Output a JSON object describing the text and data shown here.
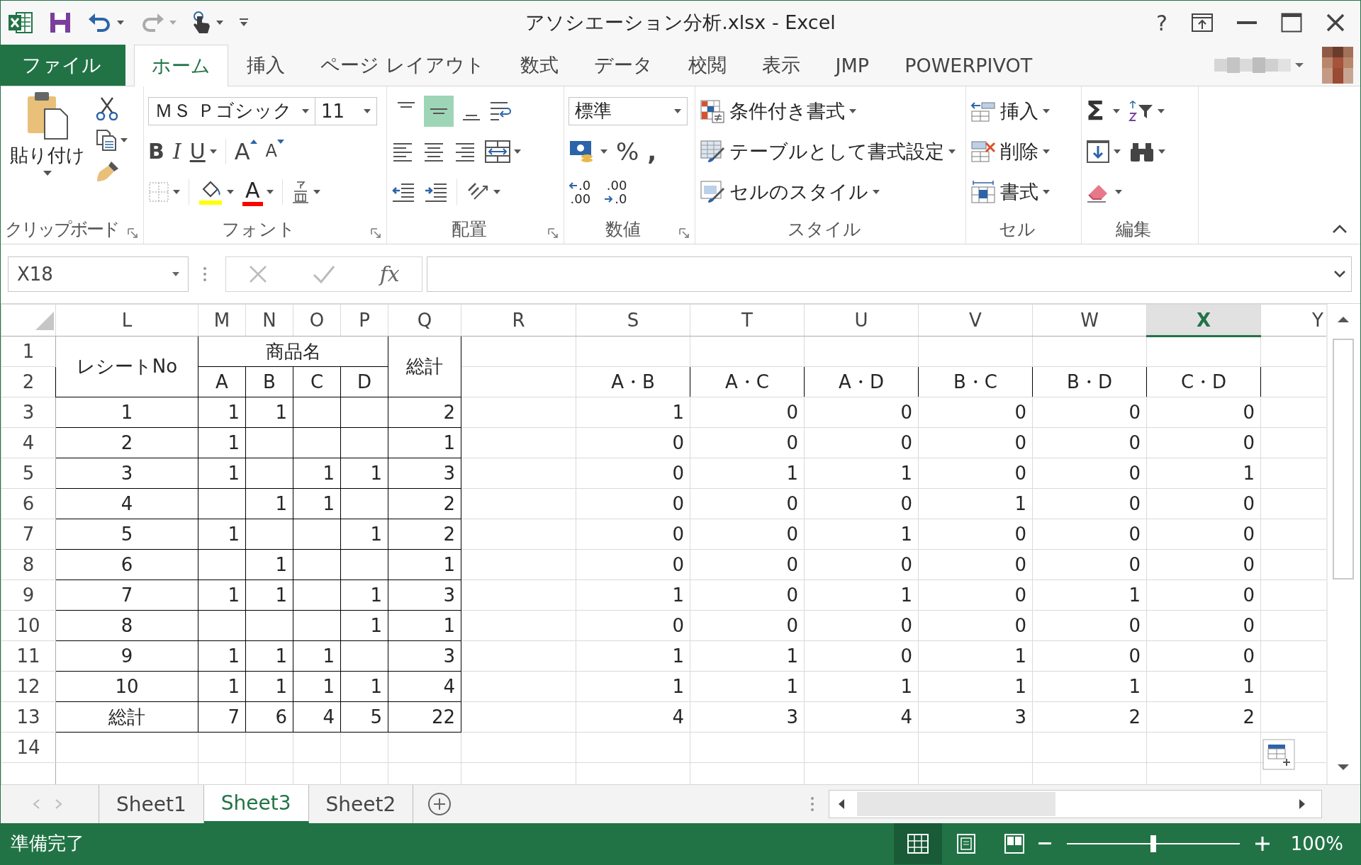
{
  "window": {
    "title": "アソシエーション分析.xlsx - Excel",
    "help": "?"
  },
  "ribbon_tabs": [
    {
      "label": "ファイル",
      "kind": "file",
      "selected": false
    },
    {
      "label": "ホーム",
      "kind": "tab",
      "selected": true
    },
    {
      "label": "挿入",
      "kind": "tab",
      "selected": false
    },
    {
      "label": "ページ レイアウト",
      "kind": "tab",
      "selected": false
    },
    {
      "label": "数式",
      "kind": "tab",
      "selected": false
    },
    {
      "label": "データ",
      "kind": "tab",
      "selected": false
    },
    {
      "label": "校閲",
      "kind": "tab",
      "selected": false
    },
    {
      "label": "表示",
      "kind": "tab",
      "selected": false
    },
    {
      "label": "JMP",
      "kind": "tab",
      "selected": false
    },
    {
      "label": "POWERPIVOT",
      "kind": "tab",
      "selected": false
    }
  ],
  "clipboard": {
    "label": "クリップボード",
    "paste": "貼り付け"
  },
  "font": {
    "label": "フォント",
    "name": "ＭＳ Ｐゴシック",
    "size": "11",
    "bold": "B",
    "italic": "I",
    "underline": "U",
    "grow": "A",
    "shrink": "A",
    "font_color": "A"
  },
  "alignment": {
    "label": "配置",
    "vertical": [
      {
        "kind": "top",
        "selected": false
      },
      {
        "kind": "middle",
        "selected": true
      },
      {
        "kind": "bottom",
        "selected": false
      }
    ]
  },
  "number": {
    "label": "数値",
    "format": "標準",
    "percent": "%",
    "comma": ",",
    "inc_decimal": [
      ".0",
      ".00"
    ],
    "dec_decimal": [
      ".00",
      ".0"
    ]
  },
  "styles": {
    "label": "スタイル",
    "items": [
      {
        "kind": "conditional",
        "label": "条件付き書式"
      },
      {
        "kind": "table",
        "label": "テーブルとして書式設定"
      },
      {
        "kind": "cell",
        "label": "セルのスタイル"
      }
    ]
  },
  "cells": {
    "label": "セル",
    "items": [
      {
        "kind": "insert",
        "label": "挿入"
      },
      {
        "kind": "delete",
        "label": "削除"
      },
      {
        "kind": "format",
        "label": "書式"
      }
    ]
  },
  "editing": {
    "label": "編集",
    "sum": "Σ"
  },
  "formula_bar": {
    "name_box": "X18",
    "fx": "fx"
  },
  "grid": {
    "column_headers": [
      {
        "label": "L",
        "selected": false
      },
      {
        "label": "M",
        "selected": false
      },
      {
        "label": "N",
        "selected": false
      },
      {
        "label": "O",
        "selected": false
      },
      {
        "label": "P",
        "selected": false
      },
      {
        "label": "Q",
        "selected": false
      },
      {
        "label": "R",
        "selected": false
      },
      {
        "label": "S",
        "selected": false
      },
      {
        "label": "T",
        "selected": false
      },
      {
        "label": "U",
        "selected": false
      },
      {
        "label": "V",
        "selected": false
      },
      {
        "label": "W",
        "selected": false
      },
      {
        "label": "X",
        "selected": true
      },
      {
        "label": "Y",
        "selected": false
      }
    ],
    "row_numbers": [
      "1",
      "2",
      "3",
      "4",
      "5",
      "6",
      "7",
      "8",
      "9",
      "10",
      "11",
      "12",
      "13",
      "14"
    ]
  },
  "table": {
    "receipt_title": "レシートNo",
    "product_title": "商品名",
    "total_title": "総計",
    "products": [
      "A",
      "B",
      "C",
      "D"
    ],
    "rows": [
      {
        "receipt": "1",
        "counts": [
          {
            "filled": true,
            "value": "1"
          },
          {
            "filled": true,
            "value": "1"
          },
          {
            "filled": false
          },
          {
            "filled": false
          }
        ],
        "total": "2"
      },
      {
        "receipt": "2",
        "counts": [
          {
            "filled": true,
            "value": "1"
          },
          {
            "filled": false
          },
          {
            "filled": false
          },
          {
            "filled": false
          }
        ],
        "total": "1"
      },
      {
        "receipt": "3",
        "counts": [
          {
            "filled": true,
            "value": "1"
          },
          {
            "filled": false
          },
          {
            "filled": true,
            "value": "1"
          },
          {
            "filled": true,
            "value": "1"
          }
        ],
        "total": "3"
      },
      {
        "receipt": "4",
        "counts": [
          {
            "filled": false
          },
          {
            "filled": true,
            "value": "1"
          },
          {
            "filled": true,
            "value": "1"
          },
          {
            "filled": false
          }
        ],
        "total": "2"
      },
      {
        "receipt": "5",
        "counts": [
          {
            "filled": true,
            "value": "1"
          },
          {
            "filled": false
          },
          {
            "filled": false
          },
          {
            "filled": true,
            "value": "1"
          }
        ],
        "total": "2"
      },
      {
        "receipt": "6",
        "counts": [
          {
            "filled": false
          },
          {
            "filled": true,
            "value": "1"
          },
          {
            "filled": false
          },
          {
            "filled": false
          }
        ],
        "total": "1"
      },
      {
        "receipt": "7",
        "counts": [
          {
            "filled": true,
            "value": "1"
          },
          {
            "filled": true,
            "value": "1"
          },
          {
            "filled": false
          },
          {
            "filled": true,
            "value": "1"
          }
        ],
        "total": "3"
      },
      {
        "receipt": "8",
        "counts": [
          {
            "filled": false
          },
          {
            "filled": false
          },
          {
            "filled": false
          },
          {
            "filled": true,
            "value": "1"
          }
        ],
        "total": "1"
      },
      {
        "receipt": "9",
        "counts": [
          {
            "filled": true,
            "value": "1"
          },
          {
            "filled": true,
            "value": "1"
          },
          {
            "filled": true,
            "value": "1"
          },
          {
            "filled": false
          }
        ],
        "total": "3"
      },
      {
        "receipt": "10",
        "counts": [
          {
            "filled": true,
            "value": "1"
          },
          {
            "filled": true,
            "value": "1"
          },
          {
            "filled": true,
            "value": "1"
          },
          {
            "filled": true,
            "value": "1"
          }
        ],
        "total": "4"
      }
    ],
    "total_row": {
      "label": "総計",
      "counts": [
        "7",
        "6",
        "4",
        "5"
      ],
      "total": "22"
    }
  },
  "pairs": {
    "headers": [
      "A・B",
      "A・C",
      "A・D",
      "B・C",
      "B・D",
      "C・D"
    ],
    "rows": [
      [
        "1",
        "0",
        "0",
        "0",
        "0",
        "0"
      ],
      [
        "0",
        "0",
        "0",
        "0",
        "0",
        "0"
      ],
      [
        "0",
        "1",
        "1",
        "0",
        "0",
        "1"
      ],
      [
        "0",
        "0",
        "0",
        "1",
        "0",
        "0"
      ],
      [
        "0",
        "0",
        "1",
        "0",
        "0",
        "0"
      ],
      [
        "0",
        "0",
        "0",
        "0",
        "0",
        "0"
      ],
      [
        "1",
        "0",
        "1",
        "0",
        "1",
        "0"
      ],
      [
        "0",
        "0",
        "0",
        "0",
        "0",
        "0"
      ],
      [
        "1",
        "1",
        "0",
        "1",
        "0",
        "0"
      ],
      [
        "1",
        "1",
        "1",
        "1",
        "1",
        "1"
      ],
      [
        "4",
        "3",
        "4",
        "3",
        "2",
        "2"
      ]
    ]
  },
  "sheet_tabs": [
    {
      "label": "Sheet1",
      "selected": false
    },
    {
      "label": "Sheet3",
      "selected": true
    },
    {
      "label": "Sheet2",
      "selected": false
    }
  ],
  "status_bar": {
    "status": "準備完了",
    "views": [
      {
        "kind": "normal",
        "selected": true
      },
      {
        "kind": "page_layout",
        "selected": false
      },
      {
        "kind": "page_break",
        "selected": false
      }
    ],
    "zoom": {
      "level": 0.5,
      "reading": "100%"
    }
  }
}
